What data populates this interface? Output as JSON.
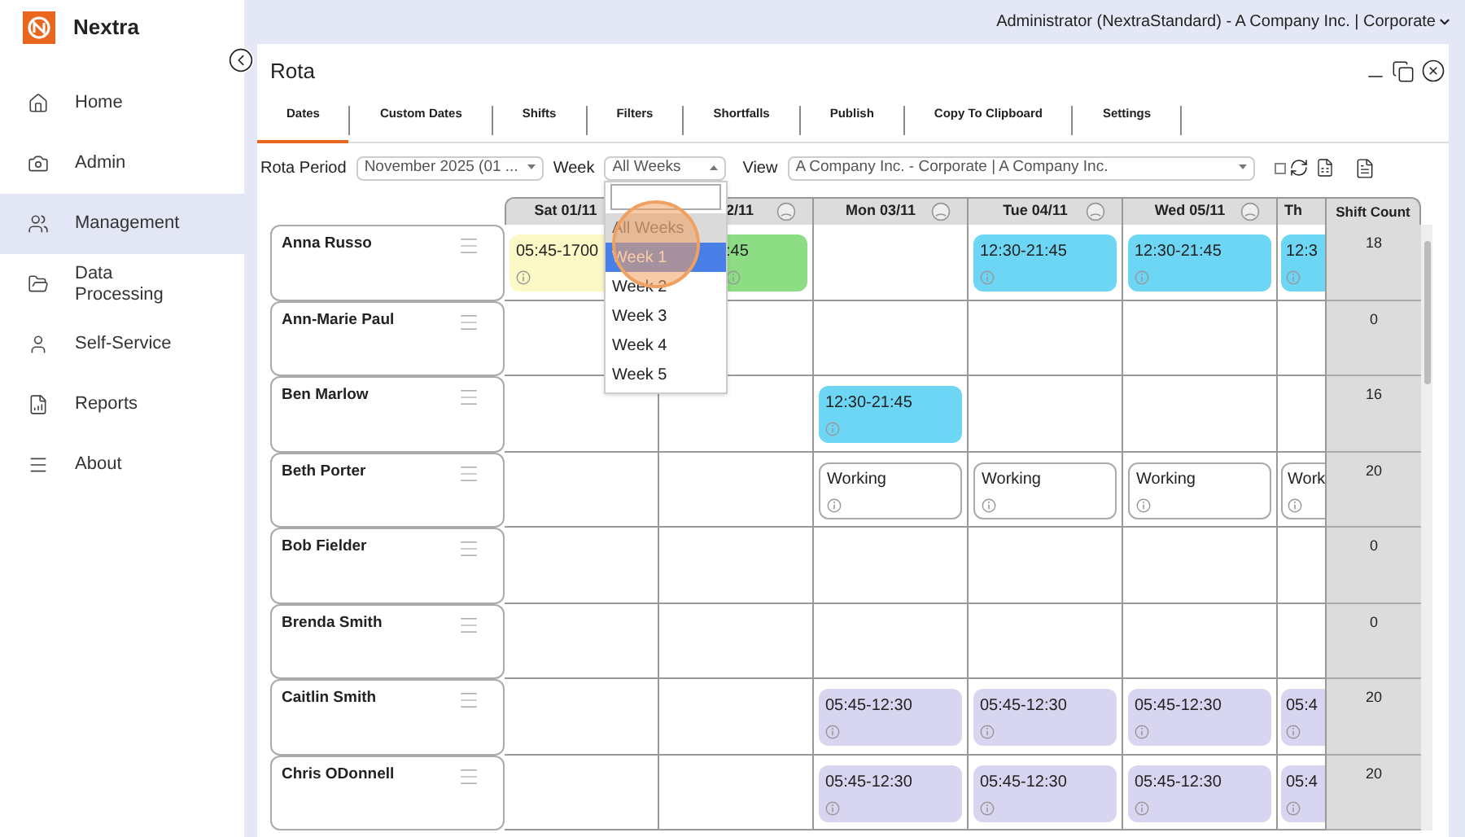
{
  "header": {
    "user": "Administrator (NextraStandard) - A Company Inc. | Corporate"
  },
  "brand": "Nextra",
  "sidebar": {
    "items": [
      {
        "label": "Home",
        "selected": false
      },
      {
        "label": "Admin",
        "selected": false
      },
      {
        "label": "Management",
        "selected": true
      },
      {
        "label": "Data Processing",
        "selected": false
      },
      {
        "label": "Self-Service",
        "selected": false
      },
      {
        "label": "Reports",
        "selected": false
      },
      {
        "label": "About",
        "selected": false
      }
    ]
  },
  "window": {
    "title": "Rota"
  },
  "tabs": [
    {
      "label": "Dates",
      "selected": true
    },
    {
      "label": "Custom Dates",
      "selected": false
    },
    {
      "label": "Shifts",
      "selected": false
    },
    {
      "label": "Filters",
      "selected": false
    },
    {
      "label": "Shortfalls",
      "selected": false
    },
    {
      "label": "Publish",
      "selected": false
    },
    {
      "label": "Copy To Clipboard",
      "selected": false
    },
    {
      "label": "Settings",
      "selected": false
    }
  ],
  "toolbar": {
    "rota_period_label": "Rota Period",
    "rota_period": "November 2025 (01 ...",
    "week_label": "Week",
    "week": "All Weeks",
    "week_open": true,
    "view_label": "View",
    "view": "A Company Inc. - Corporate | A Company Inc.",
    "checked": false
  },
  "week_menu": {
    "items": [
      {
        "label": "All Weeks",
        "selected": false,
        "current": true
      },
      {
        "label": "Week 1",
        "selected": true,
        "current": false
      },
      {
        "label": "Week 2",
        "selected": false,
        "current": false
      },
      {
        "label": "Week 3",
        "selected": false,
        "current": false
      },
      {
        "label": "Week 4",
        "selected": false,
        "current": false
      },
      {
        "label": "Week 5",
        "selected": false,
        "current": false
      }
    ]
  },
  "grid": {
    "columns": [
      {
        "label": "Sat 01/11",
        "icon": false
      },
      {
        "label": "2/11",
        "icon": true
      },
      {
        "label": "Mon 03/11",
        "icon": true
      },
      {
        "label": "Tue 04/11",
        "icon": true
      },
      {
        "label": "Wed 05/11",
        "icon": true
      },
      {
        "label": "Th",
        "icon": false
      }
    ],
    "count_label": "Shift Count",
    "rows": [
      {
        "name": "Anna Russo",
        "count": "18",
        "cells": [
          {
            "kind": "shift",
            "text": "05:45-1700",
            "color": "#fcf9c6"
          },
          {
            "kind": "shift",
            "text": ":45",
            "color": "#8ddd85"
          },
          {
            "kind": "empty"
          },
          {
            "kind": "shift",
            "text": "12:30-21:45",
            "color": "#6dd6f5"
          },
          {
            "kind": "shift",
            "text": "12:30-21:45",
            "color": "#6dd6f5"
          },
          {
            "kind": "shift",
            "text": "12:3",
            "color": "#6dd6f5"
          }
        ]
      },
      {
        "name": "Ann-Marie Paul",
        "count": "0",
        "cells": [
          {
            "kind": "empty"
          },
          {
            "kind": "empty"
          },
          {
            "kind": "empty"
          },
          {
            "kind": "empty"
          },
          {
            "kind": "empty"
          },
          {
            "kind": "empty"
          }
        ]
      },
      {
        "name": "Ben Marlow",
        "count": "16",
        "cells": [
          {
            "kind": "empty"
          },
          {
            "kind": "empty"
          },
          {
            "kind": "shift",
            "text": "12:30-21:45",
            "color": "#6dd6f5"
          },
          {
            "kind": "empty"
          },
          {
            "kind": "empty"
          },
          {
            "kind": "empty"
          }
        ]
      },
      {
        "name": "Beth Porter",
        "count": "20",
        "cells": [
          {
            "kind": "empty"
          },
          {
            "kind": "empty"
          },
          {
            "kind": "working",
            "text": "Working"
          },
          {
            "kind": "working",
            "text": "Working"
          },
          {
            "kind": "working",
            "text": "Working"
          },
          {
            "kind": "working",
            "text": "Work"
          }
        ]
      },
      {
        "name": "Bob Fielder",
        "count": "0",
        "cells": [
          {
            "kind": "empty"
          },
          {
            "kind": "empty"
          },
          {
            "kind": "empty"
          },
          {
            "kind": "empty"
          },
          {
            "kind": "empty"
          },
          {
            "kind": "empty"
          }
        ]
      },
      {
        "name": "Brenda Smith",
        "count": "0",
        "cells": [
          {
            "kind": "empty"
          },
          {
            "kind": "empty"
          },
          {
            "kind": "empty"
          },
          {
            "kind": "empty"
          },
          {
            "kind": "empty"
          },
          {
            "kind": "empty"
          }
        ]
      },
      {
        "name": "Caitlin Smith",
        "count": "20",
        "cells": [
          {
            "kind": "empty"
          },
          {
            "kind": "empty"
          },
          {
            "kind": "shift",
            "text": "05:45-12:30",
            "color": "#d7d5f0"
          },
          {
            "kind": "shift",
            "text": "05:45-12:30",
            "color": "#d7d5f0"
          },
          {
            "kind": "shift",
            "text": "05:45-12:30",
            "color": "#d7d5f0"
          },
          {
            "kind": "shift",
            "text": "05:4",
            "color": "#d7d5f0"
          }
        ]
      },
      {
        "name": "Chris ODonnell",
        "count": "20",
        "cells": [
          {
            "kind": "empty"
          },
          {
            "kind": "empty"
          },
          {
            "kind": "shift",
            "text": "05:45-12:30",
            "color": "#d7d5f0"
          },
          {
            "kind": "shift",
            "text": "05:45-12:30",
            "color": "#d7d5f0"
          },
          {
            "kind": "shift",
            "text": "05:45-12:30",
            "color": "#d7d5f0"
          },
          {
            "kind": "shift",
            "text": "05:4",
            "color": "#d7d5f0"
          }
        ]
      }
    ]
  }
}
